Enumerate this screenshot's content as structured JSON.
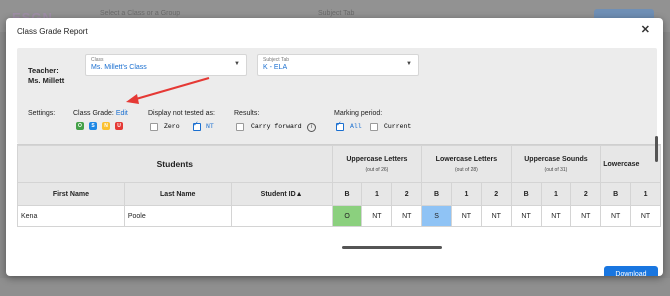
{
  "background": {
    "select_prompt": "Select a Class or a Group",
    "subject_tab_label": "Subject Tab"
  },
  "modal": {
    "title": "Class Grade Report",
    "close_icon": "close-icon"
  },
  "filters": {
    "teacher_label": "Teacher: Ms. Millett",
    "class": {
      "caption": "Class",
      "value": "Ms. Millett's Class"
    },
    "subject": {
      "caption": "Subject Tab",
      "value": "K - ELA"
    },
    "settings_label": "Settings:",
    "class_grade_label": "Class Grade:",
    "edit_label": "Edit",
    "grade_chips": [
      {
        "letter": "O",
        "color": "#43a047"
      },
      {
        "letter": "S",
        "color": "#1e88e5"
      },
      {
        "letter": "N",
        "color": "#fbc02d"
      },
      {
        "letter": "U",
        "color": "#e53935"
      }
    ],
    "display_not_tested_label": "Display not tested as:",
    "option_zero": "Zero",
    "option_nt": "NT",
    "results_label": "Results:",
    "carry_forward": "Carry forward",
    "marking_period_label": "Marking period:",
    "option_all": "All",
    "option_current": "Current"
  },
  "table": {
    "students_header": "Students",
    "columns": [
      "First Name",
      "Last Name",
      "Student ID"
    ],
    "groups": [
      {
        "title": "Uppercase Letters",
        "sub": "(out of 26)"
      },
      {
        "title": "Lowercase Letters",
        "sub": "(out of 28)"
      },
      {
        "title": "Uppercase Sounds",
        "sub": "(out of 31)"
      },
      {
        "title": "Lowercase",
        "sub": ""
      }
    ],
    "sub_columns": [
      "B",
      "1",
      "2",
      "B",
      "1",
      "2",
      "B",
      "1",
      "2",
      "B",
      "1"
    ],
    "rows": [
      {
        "first": "Kena",
        "last": "Poole",
        "id": "",
        "cells": [
          "O",
          "NT",
          "NT",
          "S",
          "NT",
          "NT",
          "NT",
          "NT",
          "NT",
          "NT",
          "NT"
        ]
      }
    ]
  },
  "download_label": "Download"
}
